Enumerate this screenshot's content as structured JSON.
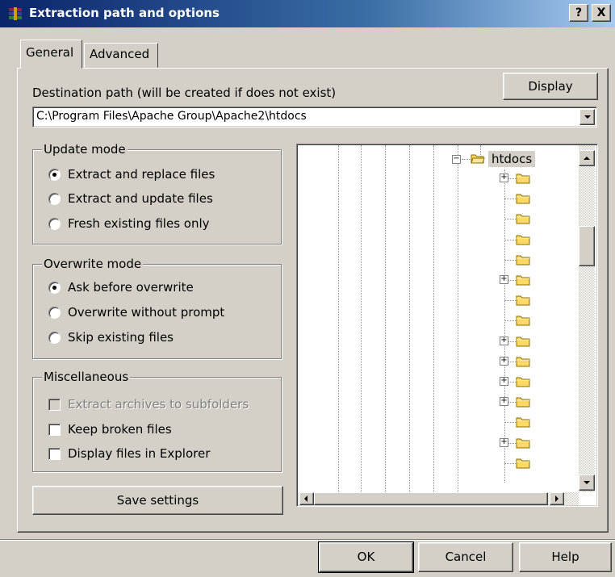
{
  "window": {
    "title": "Extraction path and options",
    "help_glyph": "?",
    "close_glyph": "X"
  },
  "tabs": [
    {
      "label": "General"
    },
    {
      "label": "Advanced"
    }
  ],
  "destination": {
    "label": "Destination path (will be created if does not exist)",
    "value": "C:\\Program Files\\Apache Group\\Apache2\\htdocs",
    "display_button": "Display"
  },
  "update_mode": {
    "title": "Update mode",
    "options": [
      {
        "label": "Extract and replace files",
        "selected": true
      },
      {
        "label": "Extract and update files",
        "selected": false
      },
      {
        "label": "Fresh existing files only",
        "selected": false
      }
    ]
  },
  "overwrite_mode": {
    "title": "Overwrite mode",
    "options": [
      {
        "label": "Ask before overwrite",
        "selected": true
      },
      {
        "label": "Overwrite without prompt",
        "selected": false
      },
      {
        "label": "Skip existing files",
        "selected": false
      }
    ]
  },
  "miscellaneous": {
    "title": "Miscellaneous",
    "options": [
      {
        "label": "Extract archives to subfolders",
        "checked": false,
        "disabled": true
      },
      {
        "label": "Keep broken files",
        "checked": false,
        "disabled": false
      },
      {
        "label": "Display files in Explorer",
        "checked": false,
        "disabled": false
      }
    ]
  },
  "save_settings_button": "Save settings",
  "tree": {
    "selected_folder": "htdocs",
    "children_expandable": [
      true,
      false,
      false,
      false,
      false,
      true,
      false,
      false,
      true,
      true,
      true,
      true,
      false,
      true,
      false
    ]
  },
  "footer": {
    "ok": "OK",
    "cancel": "Cancel",
    "help": "Help"
  },
  "colors": {
    "face": "#d4d0c8",
    "title_start": "#0a246a",
    "title_end": "#a6caf0",
    "selection": "#d4d0c8",
    "folder": "#ffd966"
  }
}
